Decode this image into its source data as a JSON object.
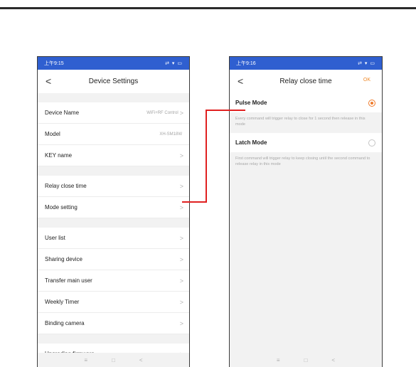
{
  "colors": {
    "accent": "#ef7a2a",
    "statusbar": "#2f5fd0",
    "connector": "#e02020"
  },
  "left_phone": {
    "status": {
      "time": "上午9:15",
      "icons": "⇄ ▾ ▭"
    },
    "header": {
      "title": "Device Settings"
    },
    "groups": [
      [
        {
          "label": "Device Name",
          "value": "WiFi+RF Control",
          "chevron": ">"
        },
        {
          "label": "Model",
          "value": "XH-SM18W",
          "chevron": ""
        },
        {
          "label": "KEY name",
          "value": "",
          "chevron": ">"
        }
      ],
      [
        {
          "label": "Relay close time",
          "value": "",
          "chevron": ">"
        },
        {
          "label": "Mode setting",
          "value": "",
          "chevron": ">"
        }
      ],
      [
        {
          "label": "User list",
          "value": "",
          "chevron": ">"
        },
        {
          "label": "Sharing device",
          "value": "",
          "chevron": ">"
        },
        {
          "label": "Transfer main user",
          "value": "",
          "chevron": ">"
        },
        {
          "label": "Weekly Timer",
          "value": "",
          "chevron": ">"
        },
        {
          "label": "Binding camera",
          "value": "",
          "chevron": ">"
        }
      ],
      [
        {
          "label": "Upgrading firmware",
          "value": "",
          "chevron": ">"
        }
      ]
    ],
    "bottom_nav": {
      "menu": "≡",
      "home": "□",
      "back": "<"
    }
  },
  "right_phone": {
    "status": {
      "time": "上午9:16",
      "icons": "⇄ ▾ ▭"
    },
    "header": {
      "title": "Relay close time",
      "ok": "OK"
    },
    "options": [
      {
        "label": "Pulse Mode",
        "checked": true,
        "desc": "Every command will trigger relay to close for 1 second then release in this mode"
      },
      {
        "label": "Latch Mode",
        "checked": false,
        "desc": "First command will trigger relay to keep closing until the second command to release relay in this mode"
      }
    ],
    "bottom_nav": {
      "menu": "≡",
      "home": "□",
      "back": "<"
    }
  },
  "back_glyph": "<"
}
